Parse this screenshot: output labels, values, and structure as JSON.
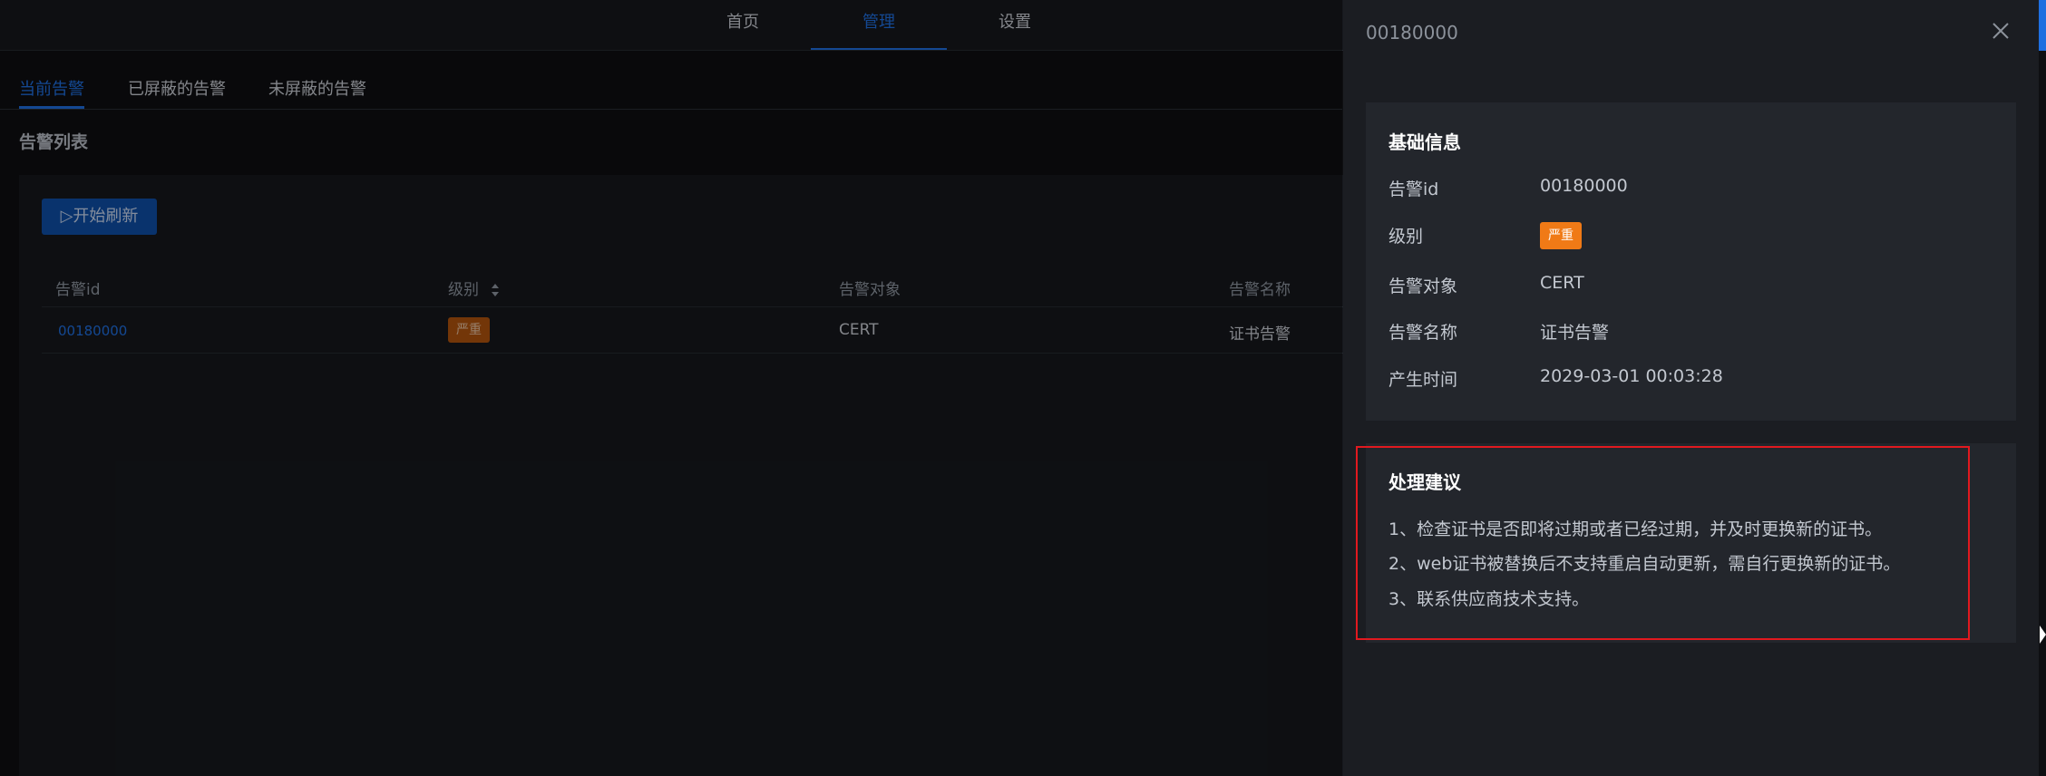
{
  "topnav": {
    "items": [
      {
        "label": "首页"
      },
      {
        "label": "管理"
      },
      {
        "label": "设置"
      }
    ],
    "active_index": 1
  },
  "subtabs": {
    "items": [
      {
        "label": "当前告警"
      },
      {
        "label": "已屏蔽的告警"
      },
      {
        "label": "未屏蔽的告警"
      }
    ],
    "active_index": 0
  },
  "list": {
    "title": "告警列表",
    "refresh_button": "▷开始刷新",
    "columns": [
      "告警id",
      "级别",
      "告警对象",
      "告警名称"
    ],
    "rows": [
      {
        "id": "00180000",
        "level": "严重",
        "object": "CERT",
        "name": "证书告警"
      }
    ]
  },
  "drawer": {
    "title": "00180000",
    "basic": {
      "title": "基础信息",
      "fields": [
        {
          "label": "告警id",
          "value": "00180000"
        },
        {
          "label": "级别",
          "value": "严重"
        },
        {
          "label": "告警对象",
          "value": "CERT"
        },
        {
          "label": "告警名称",
          "value": "证书告警"
        },
        {
          "label": "产生时间",
          "value": "2029-03-01 00:03:28"
        }
      ]
    },
    "advice": {
      "title": "处理建议",
      "lines": [
        "1、检查证书是否即将过期或者已经过期，并及时更换新的证书。",
        "2、web证书被替换后不支持重启自动更新，需自行更换新的证书。",
        "3、联系供应商技术支持。"
      ]
    }
  },
  "colors": {
    "accent": "#1f6fe0",
    "severity_critical": "#f07a16",
    "highlight_border": "#e1191f"
  },
  "icons": {
    "sort": "sort-icon",
    "close": "close-icon",
    "cursor": "cursor-icon"
  }
}
